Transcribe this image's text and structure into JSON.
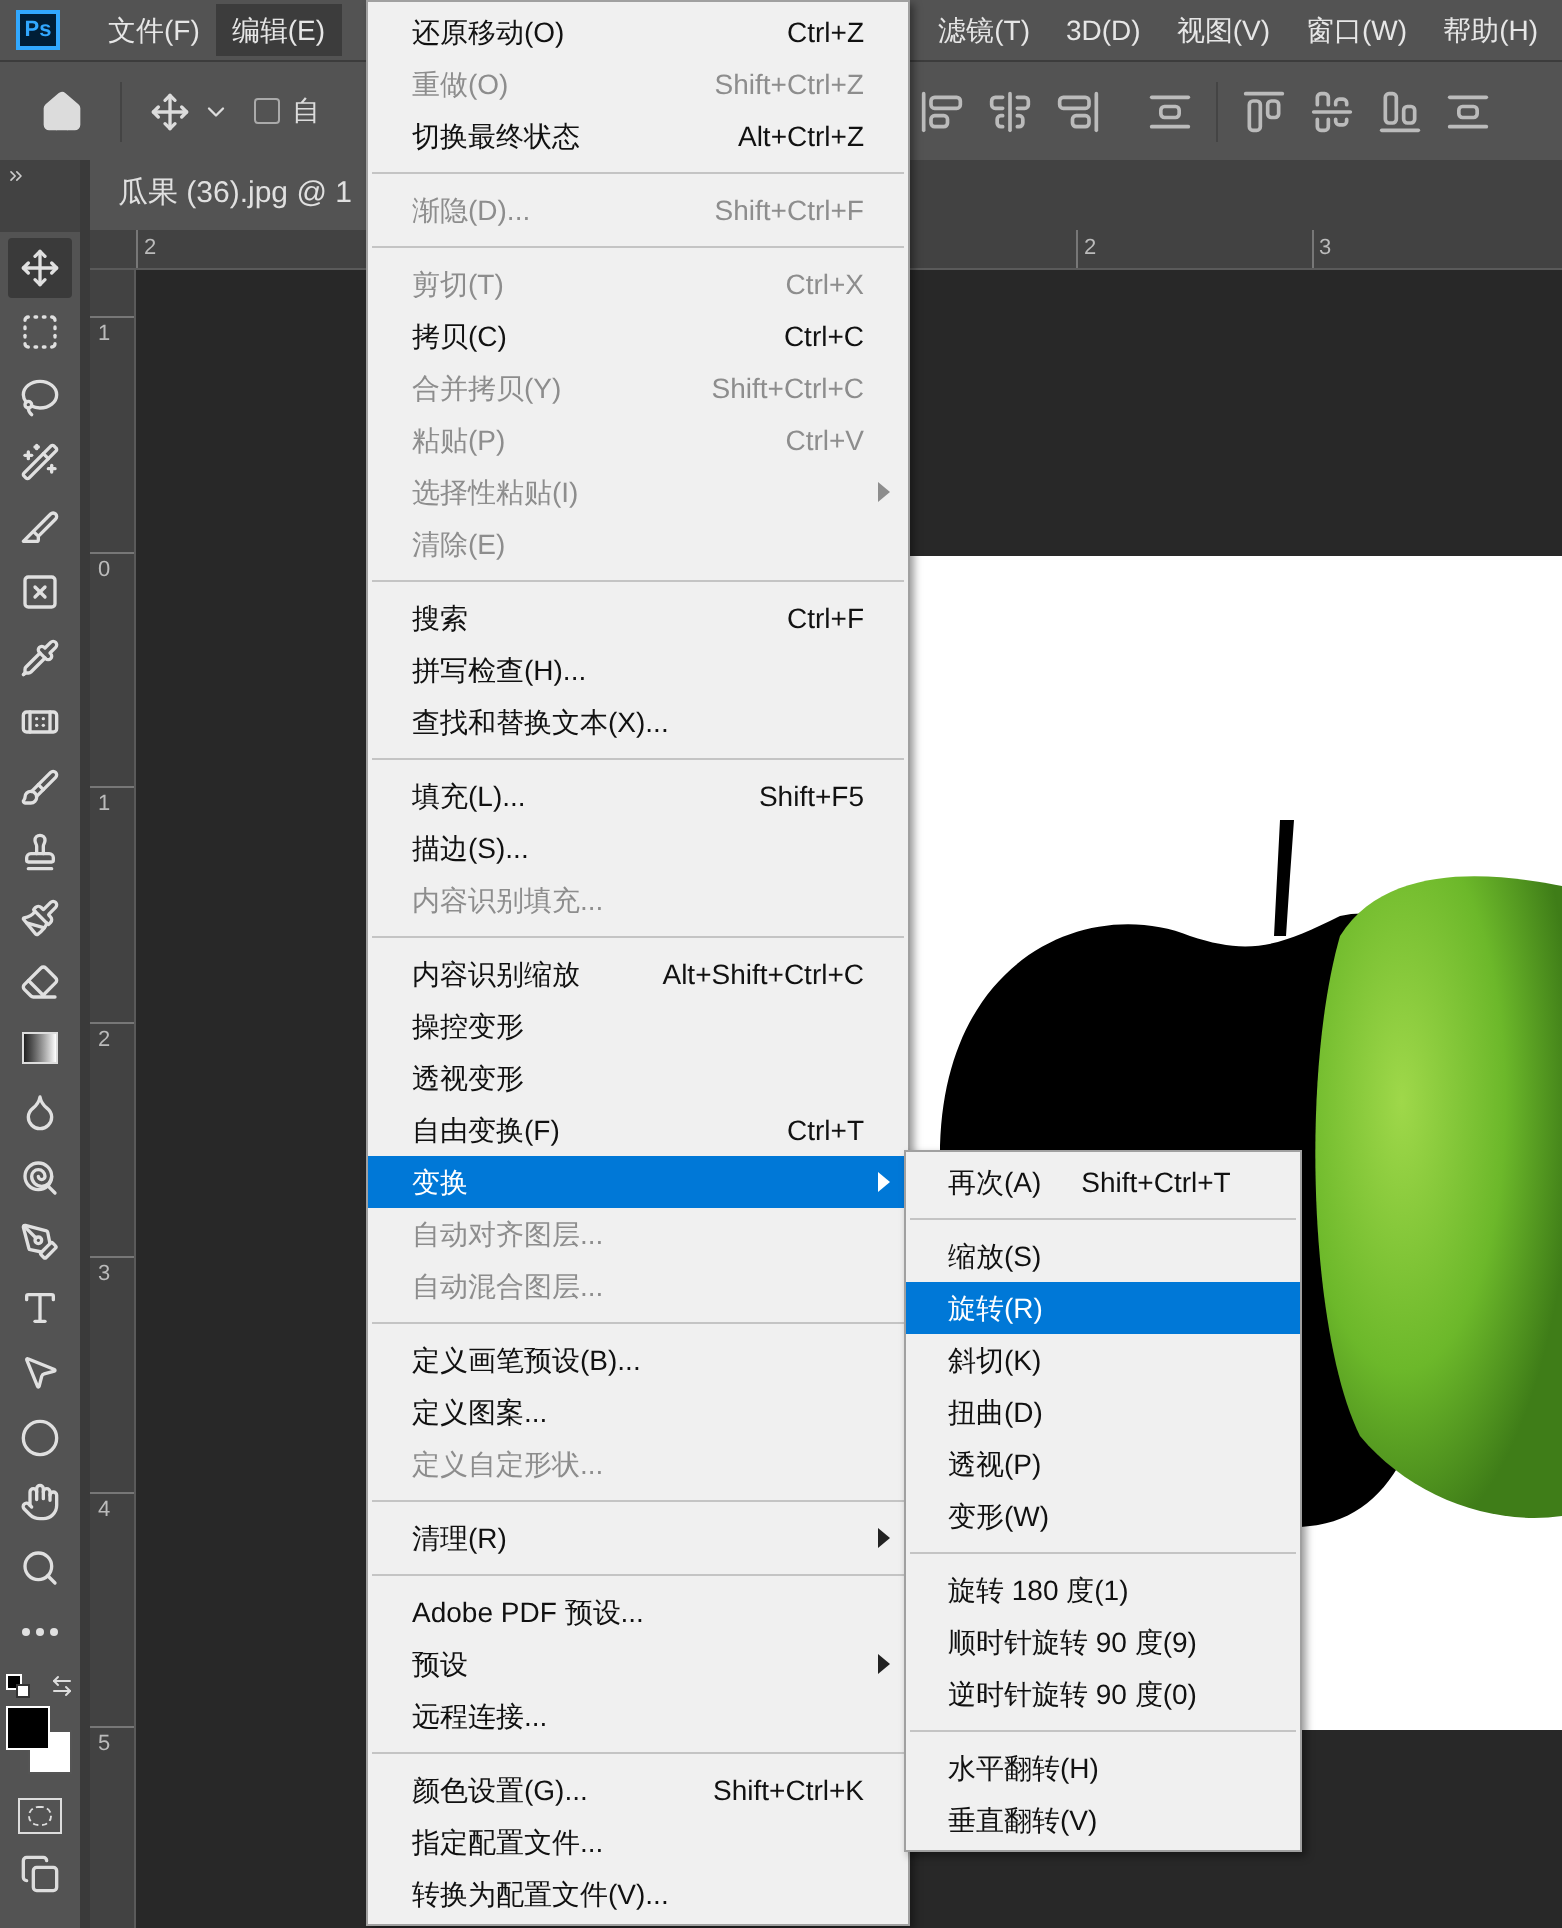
{
  "app_logo": "Ps",
  "menubar": [
    {
      "label": "文件(F)",
      "selected": false
    },
    {
      "label": "编辑(E)",
      "selected": true
    },
    {
      "label": "滤镜(T)",
      "selected": false
    },
    {
      "label": "3D(D)",
      "selected": false
    },
    {
      "label": "视图(V)",
      "selected": false
    },
    {
      "label": "窗口(W)",
      "selected": false
    },
    {
      "label": "帮助(H)",
      "selected": false
    }
  ],
  "options_bar": {
    "auto_select": {
      "label": "自",
      "checked": false
    }
  },
  "document_tab": {
    "title": "瓜果 (36).jpg @ 1"
  },
  "horizontal_ruler": [
    "2",
    "2",
    "3"
  ],
  "vertical_ruler": [
    "1",
    "0",
    "1",
    "2",
    "3",
    "4",
    "5"
  ],
  "edit_menu": [
    {
      "kind": "item",
      "label": "还原移动(O)",
      "shortcut": "Ctrl+Z",
      "disabled": false
    },
    {
      "kind": "item",
      "label": "重做(O)",
      "shortcut": "Shift+Ctrl+Z",
      "disabled": true
    },
    {
      "kind": "item",
      "label": "切换最终状态",
      "shortcut": "Alt+Ctrl+Z",
      "disabled": false
    },
    {
      "kind": "separator"
    },
    {
      "kind": "item",
      "label": "渐隐(D)...",
      "shortcut": "Shift+Ctrl+F",
      "disabled": true
    },
    {
      "kind": "separator"
    },
    {
      "kind": "item",
      "label": "剪切(T)",
      "shortcut": "Ctrl+X",
      "disabled": true
    },
    {
      "kind": "item",
      "label": "拷贝(C)",
      "shortcut": "Ctrl+C",
      "disabled": false
    },
    {
      "kind": "item",
      "label": "合并拷贝(Y)",
      "shortcut": "Shift+Ctrl+C",
      "disabled": true
    },
    {
      "kind": "item",
      "label": "粘贴(P)",
      "shortcut": "Ctrl+V",
      "disabled": true
    },
    {
      "kind": "item",
      "label": "选择性粘贴(I)",
      "disabled": true,
      "submenu": true
    },
    {
      "kind": "item",
      "label": "清除(E)",
      "disabled": true
    },
    {
      "kind": "separator"
    },
    {
      "kind": "item",
      "label": "搜索",
      "shortcut": "Ctrl+F",
      "disabled": false
    },
    {
      "kind": "item",
      "label": "拼写检查(H)...",
      "disabled": false
    },
    {
      "kind": "item",
      "label": "查找和替换文本(X)...",
      "disabled": false
    },
    {
      "kind": "separator"
    },
    {
      "kind": "item",
      "label": "填充(L)...",
      "shortcut": "Shift+F5",
      "disabled": false
    },
    {
      "kind": "item",
      "label": "描边(S)...",
      "disabled": false
    },
    {
      "kind": "item",
      "label": "内容识别填充...",
      "disabled": true
    },
    {
      "kind": "separator"
    },
    {
      "kind": "item",
      "label": "内容识别缩放",
      "shortcut": "Alt+Shift+Ctrl+C",
      "disabled": false
    },
    {
      "kind": "item",
      "label": "操控变形",
      "disabled": false
    },
    {
      "kind": "item",
      "label": "透视变形",
      "disabled": false
    },
    {
      "kind": "item",
      "label": "自由变换(F)",
      "shortcut": "Ctrl+T",
      "disabled": false
    },
    {
      "kind": "item",
      "label": "变换",
      "disabled": false,
      "submenu": true,
      "selected": true
    },
    {
      "kind": "item",
      "label": "自动对齐图层...",
      "disabled": true
    },
    {
      "kind": "item",
      "label": "自动混合图层...",
      "disabled": true
    },
    {
      "kind": "separator"
    },
    {
      "kind": "item",
      "label": "定义画笔预设(B)...",
      "disabled": false
    },
    {
      "kind": "item",
      "label": "定义图案...",
      "disabled": false
    },
    {
      "kind": "item",
      "label": "定义自定形状...",
      "disabled": true
    },
    {
      "kind": "separator"
    },
    {
      "kind": "item",
      "label": "清理(R)",
      "disabled": false,
      "submenu": true
    },
    {
      "kind": "separator"
    },
    {
      "kind": "item",
      "label": "Adobe PDF 预设...",
      "disabled": false
    },
    {
      "kind": "item",
      "label": "预设",
      "disabled": false,
      "submenu": true
    },
    {
      "kind": "item",
      "label": "远程连接...",
      "disabled": false
    },
    {
      "kind": "separator"
    },
    {
      "kind": "item",
      "label": "颜色设置(G)...",
      "shortcut": "Shift+Ctrl+K",
      "disabled": false
    },
    {
      "kind": "item",
      "label": "指定配置文件...",
      "disabled": false
    },
    {
      "kind": "item",
      "label": "转换为配置文件(V)...",
      "disabled": false
    }
  ],
  "transform_submenu": [
    {
      "kind": "item",
      "label": "再次(A)",
      "shortcut": "Shift+Ctrl+T",
      "selected": false
    },
    {
      "kind": "separator"
    },
    {
      "kind": "item",
      "label": "缩放(S)",
      "selected": false
    },
    {
      "kind": "item",
      "label": "旋转(R)",
      "selected": true
    },
    {
      "kind": "item",
      "label": "斜切(K)",
      "selected": false
    },
    {
      "kind": "item",
      "label": "扭曲(D)",
      "selected": false
    },
    {
      "kind": "item",
      "label": "透视(P)",
      "selected": false
    },
    {
      "kind": "item",
      "label": "变形(W)",
      "selected": false
    },
    {
      "kind": "separator"
    },
    {
      "kind": "item",
      "label": "旋转 180 度(1)",
      "selected": false
    },
    {
      "kind": "item",
      "label": "顺时针旋转 90 度(9)",
      "selected": false
    },
    {
      "kind": "item",
      "label": "逆时针旋转 90 度(0)",
      "selected": false
    },
    {
      "kind": "separator"
    },
    {
      "kind": "item",
      "label": "水平翻转(H)",
      "selected": false
    },
    {
      "kind": "item",
      "label": "垂直翻转(V)",
      "selected": false
    }
  ]
}
